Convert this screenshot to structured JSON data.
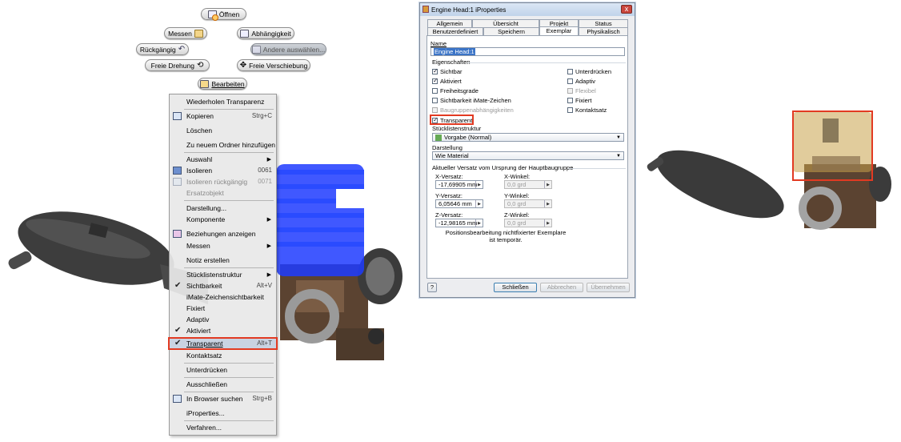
{
  "toolbar": {
    "open": "Öffnen",
    "measure": "Messen",
    "dependency": "Abhängigkeit",
    "undo": "Rückgängig",
    "select_other": "Andere auswählen...",
    "free_rotate": "Freie Drehung",
    "free_move": "Freie Verschiebung",
    "edit": "Bearbeiten"
  },
  "context_menu": {
    "items": [
      {
        "label": "Wiederholen Transparenz"
      },
      {
        "label": "Kopieren",
        "shortcut": "Strg+C"
      },
      {
        "label": "Löschen"
      },
      {
        "label": "Zu neuem Ordner hinzufügen"
      },
      {
        "label": "Auswahl"
      },
      {
        "label": "Isolieren",
        "shortcut": "0061"
      },
      {
        "label": "Isolieren rückgängig",
        "shortcut": "0071"
      },
      {
        "label": "Ersatzobjekt"
      },
      {
        "label": "Darstellung..."
      },
      {
        "label": "Komponente"
      },
      {
        "label": "Beziehungen anzeigen"
      },
      {
        "label": "Messen"
      },
      {
        "label": "Notiz erstellen"
      },
      {
        "label": "Stücklistenstruktur"
      },
      {
        "label": "Sichtbarkeit",
        "shortcut": "Alt+V"
      },
      {
        "label": "iMate-Zeichensichtbarkeit"
      },
      {
        "label": "Fixiert"
      },
      {
        "label": "Adaptiv"
      },
      {
        "label": "Aktiviert"
      },
      {
        "label": "Transparent",
        "shortcut": "Alt+T"
      },
      {
        "label": "Kontaktsatz"
      },
      {
        "label": "Unterdrücken"
      },
      {
        "label": "Ausschließen"
      },
      {
        "label": "In Browser suchen",
        "shortcut": "Strg+B"
      },
      {
        "label": "iProperties..."
      },
      {
        "label": "Verfahren..."
      }
    ]
  },
  "dialog": {
    "title": "Engine Head:1 iProperties",
    "close": "x",
    "tabs_row1": [
      "Allgemein",
      "Übersicht",
      "Projekt",
      "Status"
    ],
    "tabs_row2": [
      "Benutzerdefiniert",
      "Speichern",
      "Exemplar",
      "Physikalisch"
    ],
    "name_label": "Name",
    "name_value": "Engine Head:1",
    "properties_label": "Eigenschaften",
    "checks_left": [
      "Sichtbar",
      "Aktiviert",
      "Freiheitsgrade",
      "Sichtbarkeit iMate-Zeichen",
      "Baugruppenabhängigkeiten",
      "Transparent"
    ],
    "checks_right": [
      "Unterdrücken",
      "Adaptiv",
      "Flexibel",
      "Fixiert",
      "Kontaktsatz"
    ],
    "bom_label": "Stücklistenstruktur",
    "bom_value": "Vorgabe (Normal)",
    "display_label": "Darstellung",
    "display_value": "Wie Material",
    "offset_label": "Aktueller Versatz vom Ursprung der Hauptbaugruppe",
    "x_offset_label": "X-Versatz:",
    "x_offset": "-17,69905 mm",
    "x_angle_label": "X-Winkel:",
    "x_angle": "0,0 grd",
    "y_offset_label": "Y-Versatz:",
    "y_offset": "6,05646 mm",
    "y_angle_label": "Y-Winkel:",
    "y_angle": "0,0 grd",
    "z_offset_label": "Z-Versatz:",
    "z_offset": "-12,98165 mm",
    "z_angle_label": "Z-Winkel:",
    "z_angle": "0,0 grd",
    "note": "Positionsbearbeitung nichtfixierter Exemplare ist temporär.",
    "help": "?",
    "btn_close": "Schließen",
    "btn_cancel": "Abbrechen",
    "btn_apply": "Übernehmen"
  }
}
